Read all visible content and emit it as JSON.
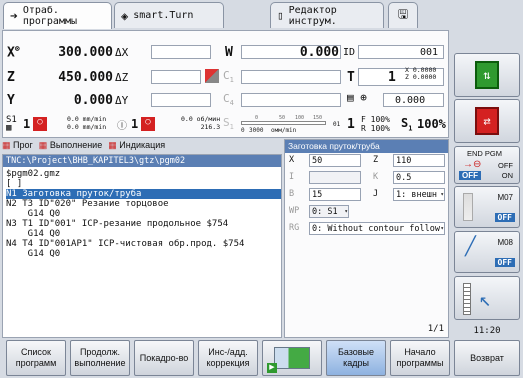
{
  "tabs": [
    {
      "label": "Отраб. программы",
      "icon": "arrow-right-icon"
    },
    {
      "label": "smart.Turn",
      "icon": "diamond-arrow-icon"
    },
    {
      "label": "Редактор инструм.",
      "icon": "tool-editor-icon"
    },
    {
      "label": "",
      "icon": "save-icon"
    }
  ],
  "position": {
    "x_label": "X",
    "x_sup": "⊗",
    "x_value": "300.000",
    "x_delta": "ΔX",
    "z_label": "Z",
    "z_value": "450.000",
    "z_delta": "ΔZ",
    "y_label": "Y",
    "y_value": "0.000",
    "y_delta": "ΔY",
    "w_label": "W",
    "w_value": "0.000",
    "id_label": "ID",
    "id_value": "001",
    "t_label": "T",
    "t_value": "1",
    "tx_label": "X",
    "tx_value": "0.0000",
    "tz_label": "Z",
    "tz_value": "0.0000",
    "c1_label": "C",
    "c1_sub": "1",
    "c4_label": "C",
    "c4_sub": "4",
    "c4_value": "0.000",
    "s1_label": "S1",
    "s1_value": "1",
    "feed_a": "0.0 mm/min",
    "feed_b": "0.0 mm/min",
    "spindle_one": "1",
    "rev_a": "0.0 об/мин",
    "rev_b": "216.3",
    "s_label": "S",
    "s_sub": "1",
    "scale_ticks": [
      "0",
      "50",
      "100",
      "150"
    ],
    "scale_left": "0",
    "scale_value": "3000",
    "scale_unit": "омм/min",
    "tool_label": "01",
    "tool_num": "1",
    "f_override": "F 100%",
    "r_override": "R 100%",
    "s_override_label": "S",
    "s_override_sub": "1",
    "s_override": "100%"
  },
  "subtabs": [
    {
      "label": "Прог",
      "icon": "grid-icon"
    },
    {
      "label": "Выполнение",
      "icon": "grid-icon"
    },
    {
      "label": "Индикация",
      "icon": "grid-icon"
    }
  ],
  "program": {
    "path": "TNC:\\Project\\BHB_KAPITEL3\\gtz\\pgm02",
    "lines": [
      "$pgm02.gmz",
      "[ ]",
      "N1 Заготовка пруток/труба",
      "N2 T3 ID\"020\" Резание торцовое",
      "    G14 Q0",
      "N3 T1 ID\"001\" ICP-резание продольное $754",
      "    G14 Q0",
      "N4 T4 ID\"001AP1\" ICP-чистовая обр.прод. $754",
      "    G14 Q0"
    ],
    "selected_index": 2
  },
  "form": {
    "title": "Заготовка пруток/труба",
    "x_label": "X",
    "x_value": "50",
    "z_label": "Z",
    "z_value": "110",
    "i_label": "I",
    "i_value": "",
    "k_label": "K",
    "k_value": "0.5",
    "b_label": "B",
    "b_value": "15",
    "j_label": "J",
    "j_value": "1: внешн",
    "wp_label": "WP",
    "wp_value": "0: S1",
    "rg_label": "RG",
    "rg_value": "0: Without contour follow-",
    "page": "1/1"
  },
  "right_panel": {
    "end_pgm": "END PGM",
    "off": "OFF",
    "on": "ON",
    "m07": "M07",
    "m08": "M08",
    "clock": "11:20"
  },
  "bottom": [
    "Список программ",
    "Продолж. выполнение",
    "Покадро-во",
    "Инс-/адд. коррекция",
    "",
    "Базовые кадры",
    "Начало программы",
    "Возврат"
  ]
}
